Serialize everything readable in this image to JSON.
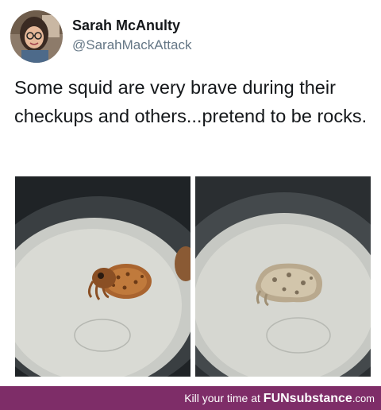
{
  "author": {
    "name": "Sarah McAnulty",
    "handle": "@SarahMackAttack"
  },
  "tweet": {
    "text": "Some squid are very brave during their checkups and others...pretend to be rocks."
  },
  "footer": {
    "tagline": "Kill your time at",
    "brand": "FUNsubstance",
    "domain": ".com",
    "background": "#7e2d68"
  }
}
